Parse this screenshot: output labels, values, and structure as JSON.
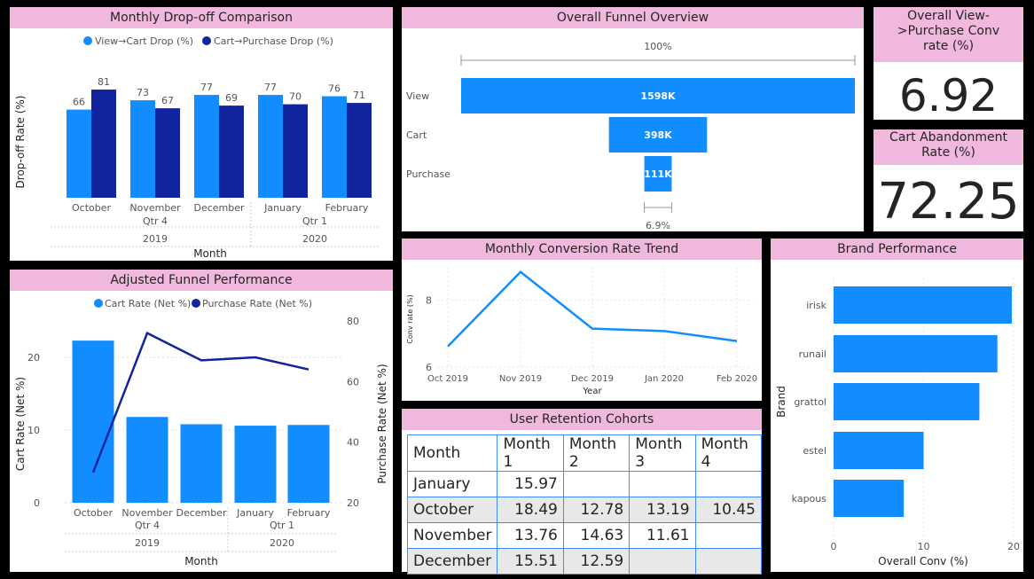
{
  "colors": {
    "light": "#118dff",
    "dark": "#12239e",
    "title_bg": "#f0b8dd"
  },
  "panels": {
    "dropoff_title": "Monthly Drop-off Comparison",
    "funnel_title": "Overall Funnel Overview",
    "adjusted_title": "Adjusted Funnel Performance",
    "trend_title": "Monthly Conversion Rate Trend",
    "brand_title": "Brand Performance",
    "cohort_title": "User Retention Cohorts"
  },
  "kpis": {
    "conv_title": "Overall View->Purchase Conv rate (%)",
    "conv_value": "6.92",
    "abandon_title": "Cart Abandonment Rate (%)",
    "abandon_value": "72.25"
  },
  "chart_data": [
    {
      "id": "dropoff",
      "type": "bar",
      "categories": [
        "October",
        "November",
        "December",
        "January",
        "February"
      ],
      "quarters": [
        {
          "label": "Qtr 4",
          "year": "2019"
        },
        {
          "label": "Qtr 1",
          "year": "2020"
        }
      ],
      "series": [
        {
          "name": "View→Cart Drop (%)",
          "values": [
            66,
            73,
            77,
            77,
            76
          ]
        },
        {
          "name": "Cart→Purchase Drop (%)",
          "values": [
            81,
            67,
            69,
            70,
            71
          ]
        }
      ],
      "xlabel": "Month",
      "ylabel": "Drop-off Rate (%)",
      "ylim": [
        0,
        85
      ],
      "legend": "top"
    },
    {
      "id": "funnel",
      "type": "bar",
      "categories": [
        "View",
        "Cart",
        "Purchase"
      ],
      "values": [
        1598,
        398,
        111
      ],
      "value_labels": [
        "1598K",
        "398K",
        "111K"
      ],
      "top_label": "100%",
      "bottom_label": "6.9%"
    },
    {
      "id": "adjusted",
      "type": "bar+line",
      "categories": [
        "October",
        "November",
        "December",
        "January",
        "February"
      ],
      "quarters": [
        {
          "label": "Qtr 4",
          "year": "2019"
        },
        {
          "label": "Qtr 1",
          "year": "2020"
        }
      ],
      "series": [
        {
          "name": "Cart Rate (Net %)",
          "type": "bar",
          "axis": "left",
          "values": [
            22.3,
            11.8,
            10.8,
            10.6,
            10.7
          ]
        },
        {
          "name": "Purchase Rate (Net %)",
          "type": "line",
          "axis": "right",
          "values": [
            30,
            76,
            67,
            68,
            64
          ]
        }
      ],
      "xlabel": "Month",
      "ylabel": "Cart Rate (Net %)",
      "y2label": "Purchase Rate (Net %)",
      "ylim": [
        0,
        25
      ],
      "yticks": [
        0,
        10,
        20
      ],
      "y2lim": [
        20,
        80
      ],
      "y2ticks": [
        20,
        40,
        60,
        80
      ],
      "legend": "top"
    },
    {
      "id": "trend",
      "type": "line",
      "x": [
        "Oct 2019",
        "Nov 2019",
        "Dec 2019",
        "Jan 2020",
        "Feb 2020"
      ],
      "values": [
        6.62,
        8.85,
        7.15,
        7.08,
        6.78
      ],
      "xlabel": "Year",
      "ylabel": "Conv rate (%)",
      "ylim": [
        6,
        9
      ],
      "yticks": [
        6,
        8
      ]
    },
    {
      "id": "brand",
      "type": "bar",
      "orientation": "horizontal",
      "categories": [
        "irisk",
        "runail",
        "grattol",
        "estel",
        "kapous"
      ],
      "values": [
        19.8,
        18.2,
        16.2,
        10.0,
        7.8
      ],
      "xlabel": "Overall Conv (%)",
      "ylabel": "Brand",
      "xlim": [
        0,
        21
      ],
      "xticks": [
        0,
        10,
        20
      ]
    },
    {
      "id": "cohort",
      "type": "table",
      "columns": [
        "Month",
        "Month 1",
        "Month 2",
        "Month 3",
        "Month 4"
      ],
      "rows": [
        [
          "January",
          "15.97",
          "",
          "",
          ""
        ],
        [
          "October",
          "18.49",
          "12.78",
          "13.19",
          "10.45"
        ],
        [
          "November",
          "13.76",
          "14.63",
          "11.61",
          ""
        ],
        [
          "December",
          "15.51",
          "12.59",
          "",
          ""
        ]
      ]
    }
  ]
}
